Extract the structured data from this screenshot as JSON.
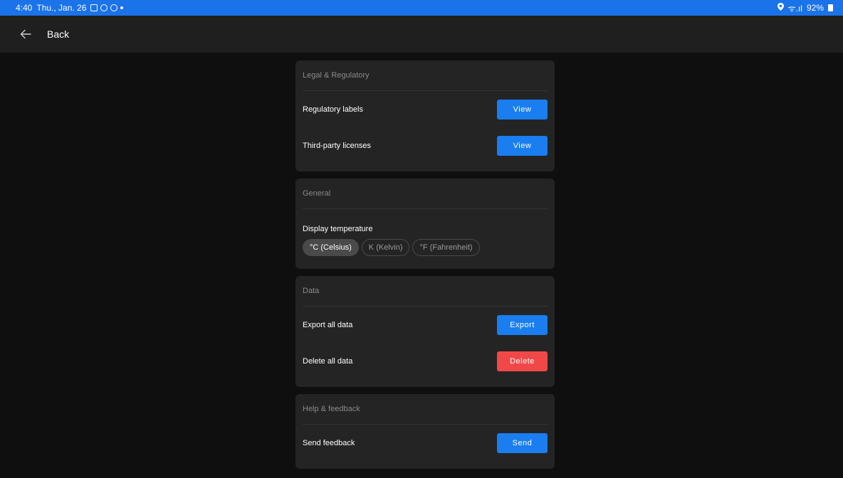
{
  "status_bar": {
    "time": "4:40",
    "date": "Thu., Jan. 26",
    "battery": "92%",
    "signal": "ᯤ.ıl"
  },
  "app_bar": {
    "back_label": "Back",
    "back_icon": "arrow-left-icon"
  },
  "sections": {
    "legal": {
      "title": "Legal & Regulatory",
      "rows": [
        {
          "label": "Regulatory labels",
          "button": "View"
        },
        {
          "label": "Third-party licenses",
          "button": "View"
        }
      ]
    },
    "general": {
      "title": "General",
      "temperature_label": "Display temperature",
      "options": [
        {
          "label": "°C (Celsius)",
          "selected": true
        },
        {
          "label": "K (Kelvin)",
          "selected": false
        },
        {
          "label": "°F (Fahrenheit)",
          "selected": false
        }
      ]
    },
    "data": {
      "title": "Data",
      "rows": [
        {
          "label": "Export all data",
          "button": "Export"
        },
        {
          "label": "Delete all data",
          "button": "Delete"
        }
      ]
    },
    "help": {
      "title": "Help & feedback",
      "rows": [
        {
          "label": "Send feedback",
          "button": "Send"
        }
      ]
    }
  },
  "colors": {
    "status_bar": "#1a73e8",
    "primary_button": "#1a7ef0",
    "danger_button": "#f04848",
    "card": "#242424",
    "background": "#0f0f0f"
  }
}
